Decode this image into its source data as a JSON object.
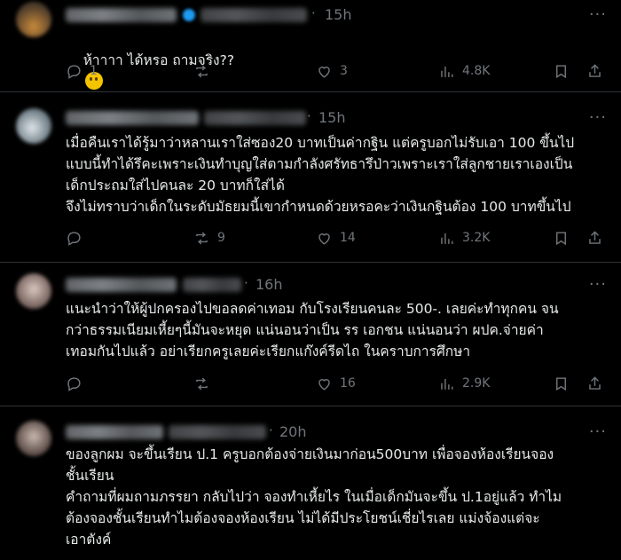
{
  "posts": [
    {
      "time": "15h",
      "text": "ห้าาาา ได้หรอ ถามจริง??",
      "emoji": "thinking-face",
      "replies": "1",
      "reposts": "",
      "likes": "3",
      "views": "4.8K"
    },
    {
      "time": "15h",
      "text": "เมื่อคืนเราได้รู้มาว่าหลานเราใส่ซอง20 บาทเป็นค่ากฐิน แต่ครูบอกไม่รับเอา 100 ขึ้นไป\nแบบนี้ทำได้รึคะเพราะเงินทำบุญใส่ตามกำลังศรัทธารึป่าวเพราะเราใส่ลูกชายเราเองเป็น\nเด็กประถมใส่ไปคนละ 20 บาทก็ใส่ได้\nจึงไม่ทราบว่าเด็กในระดับมัธยมนี้เขากำหนดด้วยหรอคะว่าเงินกฐินต้อง 100 บาทขึ้นไป",
      "replies": "",
      "reposts": "9",
      "likes": "14",
      "views": "3.2K"
    },
    {
      "time": "16h",
      "text": "แนะนำว่าให้ผู้ปกครองไปขอลดค่าเทอม กับโรงเรียนคนละ 500-. เลยค่ะทำทุกคน จน\nกว่าธรรมเนียมเหี้ยๆนี้มันจะหยุด แน่นอนว่าเป็น รร เอกชน แน่นอนว่า ผปค.จ่ายค่า\nเทอมกันไปแล้ว อย่าเรียกครูเลยค่ะเรียกแก๊งค์รีดไถ ในคราบการศึกษา",
      "replies": "",
      "reposts": "",
      "likes": "16",
      "views": "2.9K"
    },
    {
      "time": "20h",
      "text": "ของลูกผม จะขึ้นเรียน ป.1 ครูบอกต้องจ่ายเงินมาก่อน500บาท เพื่อจองห้องเรียนจอง\nชั้นเรียน\nคำถามที่ผมถามภรรยา กลับไปว่า จองทำเหี้ยไร ในเมื่อเด็กมันจะขึ้น ป.1อยู่แล้ว ทำไม\nต้องจองชั้นเรียนทำไมต้องจองห้องเรียน ไม่ได้มีประโยชน์เชี่ยไรเลย แม่งจ้องแต่จะ\nเอาตังค์"
    }
  ]
}
